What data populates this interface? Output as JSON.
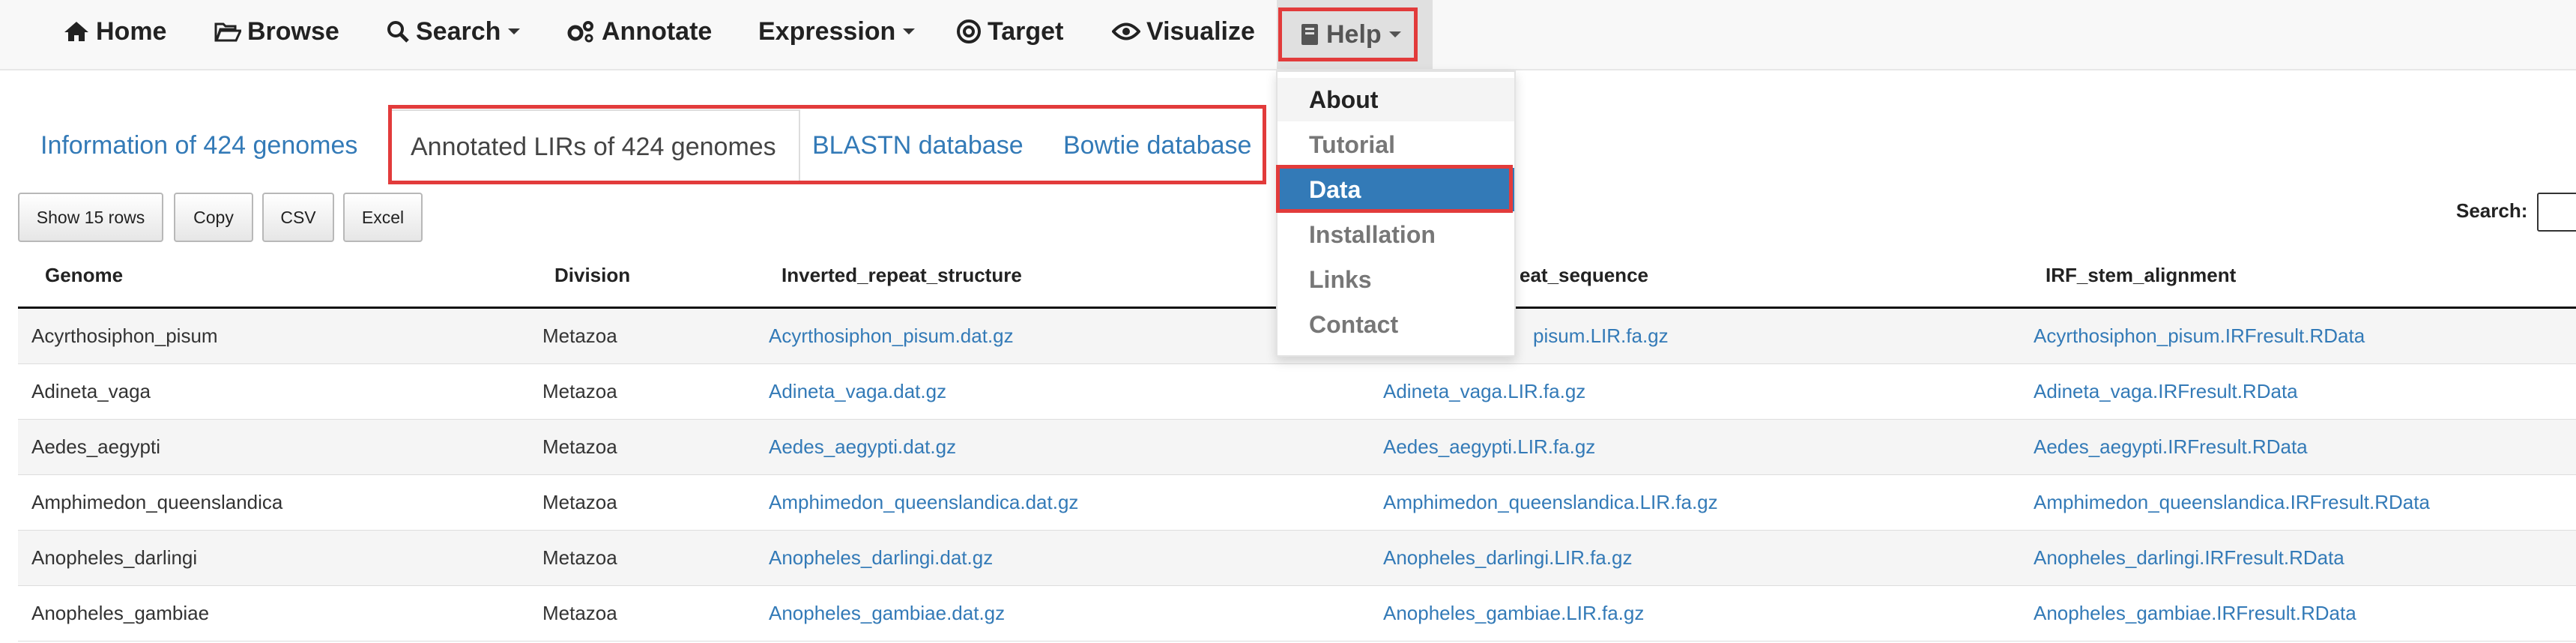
{
  "navbar": {
    "home": "Home",
    "browse": "Browse",
    "search": "Search",
    "annotate": "Annotate",
    "expression": "Expression",
    "target": "Target",
    "visualize": "Visualize",
    "help": "Help"
  },
  "help_menu": {
    "items": [
      "About",
      "Tutorial",
      "Data",
      "Installation",
      "Links",
      "Contact"
    ],
    "active": "Data"
  },
  "tabs": {
    "info": "Information of 424 genomes",
    "annotated": "Annotated LIRs of 424 genomes",
    "blastn": "BLASTN database",
    "bowtie": "Bowtie database"
  },
  "toolbar": {
    "show_rows": "Show 15 rows",
    "copy": "Copy",
    "csv": "CSV",
    "excel": "Excel",
    "search_label": "Search:"
  },
  "table": {
    "headers": [
      "Genome",
      "Division",
      "Inverted_repeat_structure",
      "eat_sequence",
      "IRF_stem_alignment"
    ],
    "rows": [
      [
        "Acyrthosiphon_pisum",
        "Metazoa",
        "Acyrthosiphon_pisum.dat.gz",
        "pisum.LIR.fa.gz",
        "Acyrthosiphon_pisum.IRFresult.RData"
      ],
      [
        "Adineta_vaga",
        "Metazoa",
        "Adineta_vaga.dat.gz",
        "Adineta_vaga.LIR.fa.gz",
        "Adineta_vaga.IRFresult.RData"
      ],
      [
        "Aedes_aegypti",
        "Metazoa",
        "Aedes_aegypti.dat.gz",
        "Aedes_aegypti.LIR.fa.gz",
        "Aedes_aegypti.IRFresult.RData"
      ],
      [
        "Amphimedon_queenslandica",
        "Metazoa",
        "Amphimedon_queenslandica.dat.gz",
        "Amphimedon_queenslandica.LIR.fa.gz",
        "Amphimedon_queenslandica.IRFresult.RData"
      ],
      [
        "Anopheles_darlingi",
        "Metazoa",
        "Anopheles_darlingi.dat.gz",
        "Anopheles_darlingi.LIR.fa.gz",
        "Anopheles_darlingi.IRFresult.RData"
      ],
      [
        "Anopheles_gambiae",
        "Metazoa",
        "Anopheles_gambiae.dat.gz",
        "Anopheles_gambiae.LIR.fa.gz",
        "Anopheles_gambiae.IRFresult.RData"
      ]
    ]
  },
  "colors": {
    "link": "#337ab7",
    "highlight_box": "#e23b3b",
    "active_menu": "#337ab7"
  }
}
